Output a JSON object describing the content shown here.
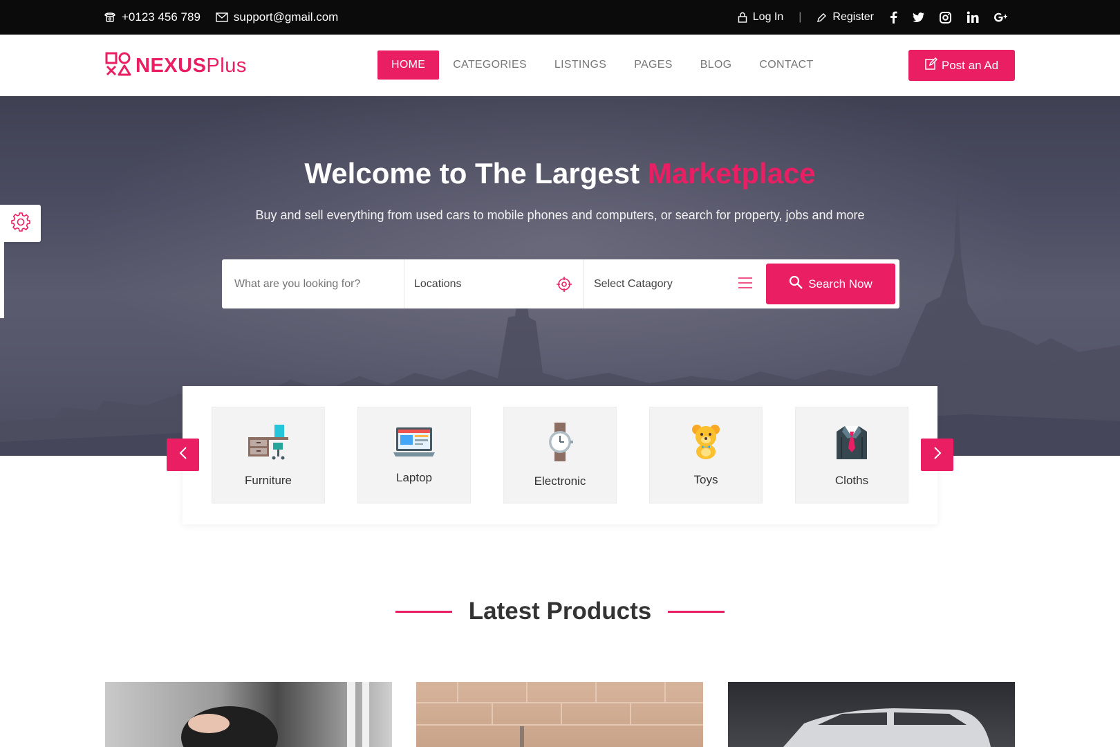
{
  "topbar": {
    "phone": "+0123 456 789",
    "email": "support@gmail.com",
    "login": "Log In",
    "separator": "|",
    "register": "Register",
    "social": [
      "facebook-icon",
      "twitter-icon",
      "instagram-icon",
      "linkedin-icon",
      "google-plus-icon"
    ]
  },
  "brand": {
    "name_bold": "NEXUS",
    "name_light": "Plus",
    "color": "#e91e63"
  },
  "nav": {
    "items": [
      "HOME",
      "CATEGORIES",
      "LISTINGS",
      "PAGES",
      "BLOG",
      "CONTACT"
    ],
    "active": "HOME"
  },
  "header": {
    "post_ad": "Post an Ad"
  },
  "hero": {
    "title_main": "Welcome to The Largest ",
    "title_accent": "Marketplace",
    "subtitle": "Buy and sell everything from used cars to mobile phones and computers, or search for property, jobs and more"
  },
  "search": {
    "keyword_placeholder": "What are you looking for?",
    "location_label": "Locations",
    "category_label": "Select Catagory",
    "button": "Search Now"
  },
  "categories": [
    {
      "label": "Furniture",
      "icon": "furniture-icon"
    },
    {
      "label": "Laptop",
      "icon": "laptop-icon"
    },
    {
      "label": "Electronic",
      "icon": "watch-icon"
    },
    {
      "label": "Toys",
      "icon": "teddy-bear-icon"
    },
    {
      "label": "Cloths",
      "icon": "suit-icon"
    }
  ],
  "latest": {
    "title": "Latest Products"
  }
}
